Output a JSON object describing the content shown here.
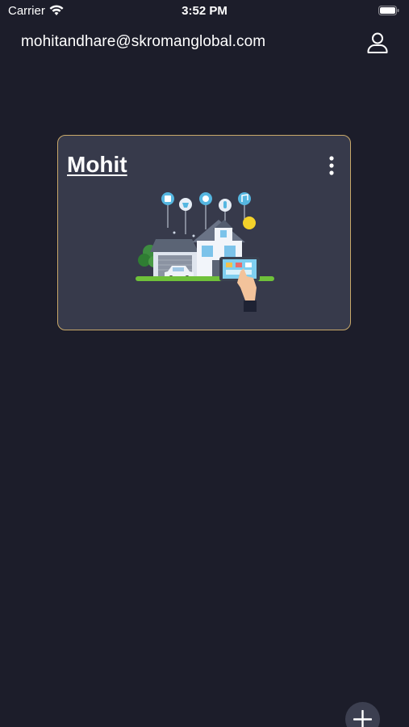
{
  "status_bar": {
    "carrier": "Carrier",
    "time": "3:52 PM",
    "icons": [
      "wifi-icon",
      "battery-icon"
    ]
  },
  "header": {
    "email": "mohitandhare@skromanglobal.com",
    "profile_icon": "user-icon"
  },
  "homes": [
    {
      "name": "Mohit",
      "menu_icon": "more-vertical-icon",
      "illustration": "smart-home-illustration"
    }
  ],
  "fab": {
    "icon": "plus-icon"
  },
  "colors": {
    "background": "#1c1d2a",
    "card": "#373a4b",
    "card_border": "#c9a96a",
    "text": "#ffffff"
  }
}
